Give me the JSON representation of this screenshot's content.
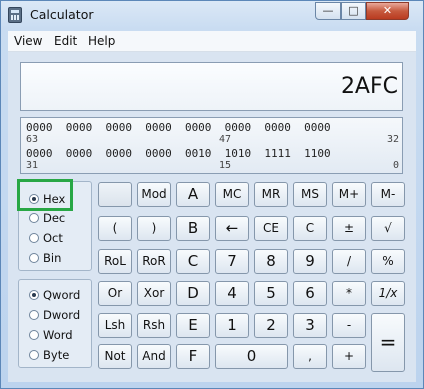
{
  "window": {
    "title": "Calculator"
  },
  "controls": {
    "minimize": "—",
    "maximize": "□",
    "close": "✕"
  },
  "menu": {
    "view": "View",
    "edit": "Edit",
    "help": "Help"
  },
  "display": {
    "value": "2AFC"
  },
  "bits": {
    "row1": "0000  0000  0000  0000  0000  0000  0000  0000",
    "row1_idx": [
      "63",
      "47",
      "32"
    ],
    "row2": "0000  0000  0000  0000  0010  1010  1111  1100",
    "row2_idx": [
      "31",
      "15",
      "0"
    ]
  },
  "base_options": [
    "Hex",
    "Dec",
    "Oct",
    "Bin"
  ],
  "base_selected": "Hex",
  "word_options": [
    "Qword",
    "Dword",
    "Word",
    "Byte"
  ],
  "word_selected": "Qword",
  "buttons": {
    "row1": [
      "",
      "Mod",
      "A",
      "MC",
      "MR",
      "MS",
      "M+",
      "M-"
    ],
    "row2": [
      "(",
      ")",
      "B",
      "←",
      "CE",
      "C",
      "±",
      "√"
    ],
    "row3": [
      "RoL",
      "RoR",
      "C",
      "7",
      "8",
      "9",
      "/",
      "%"
    ],
    "row4": [
      "Or",
      "Xor",
      "D",
      "4",
      "5",
      "6",
      "*",
      "1/x"
    ],
    "row5": [
      "Lsh",
      "Rsh",
      "E",
      "1",
      "2",
      "3",
      "-",
      "="
    ],
    "row6": [
      "Not",
      "And",
      "F",
      "0",
      ",",
      "+"
    ]
  }
}
